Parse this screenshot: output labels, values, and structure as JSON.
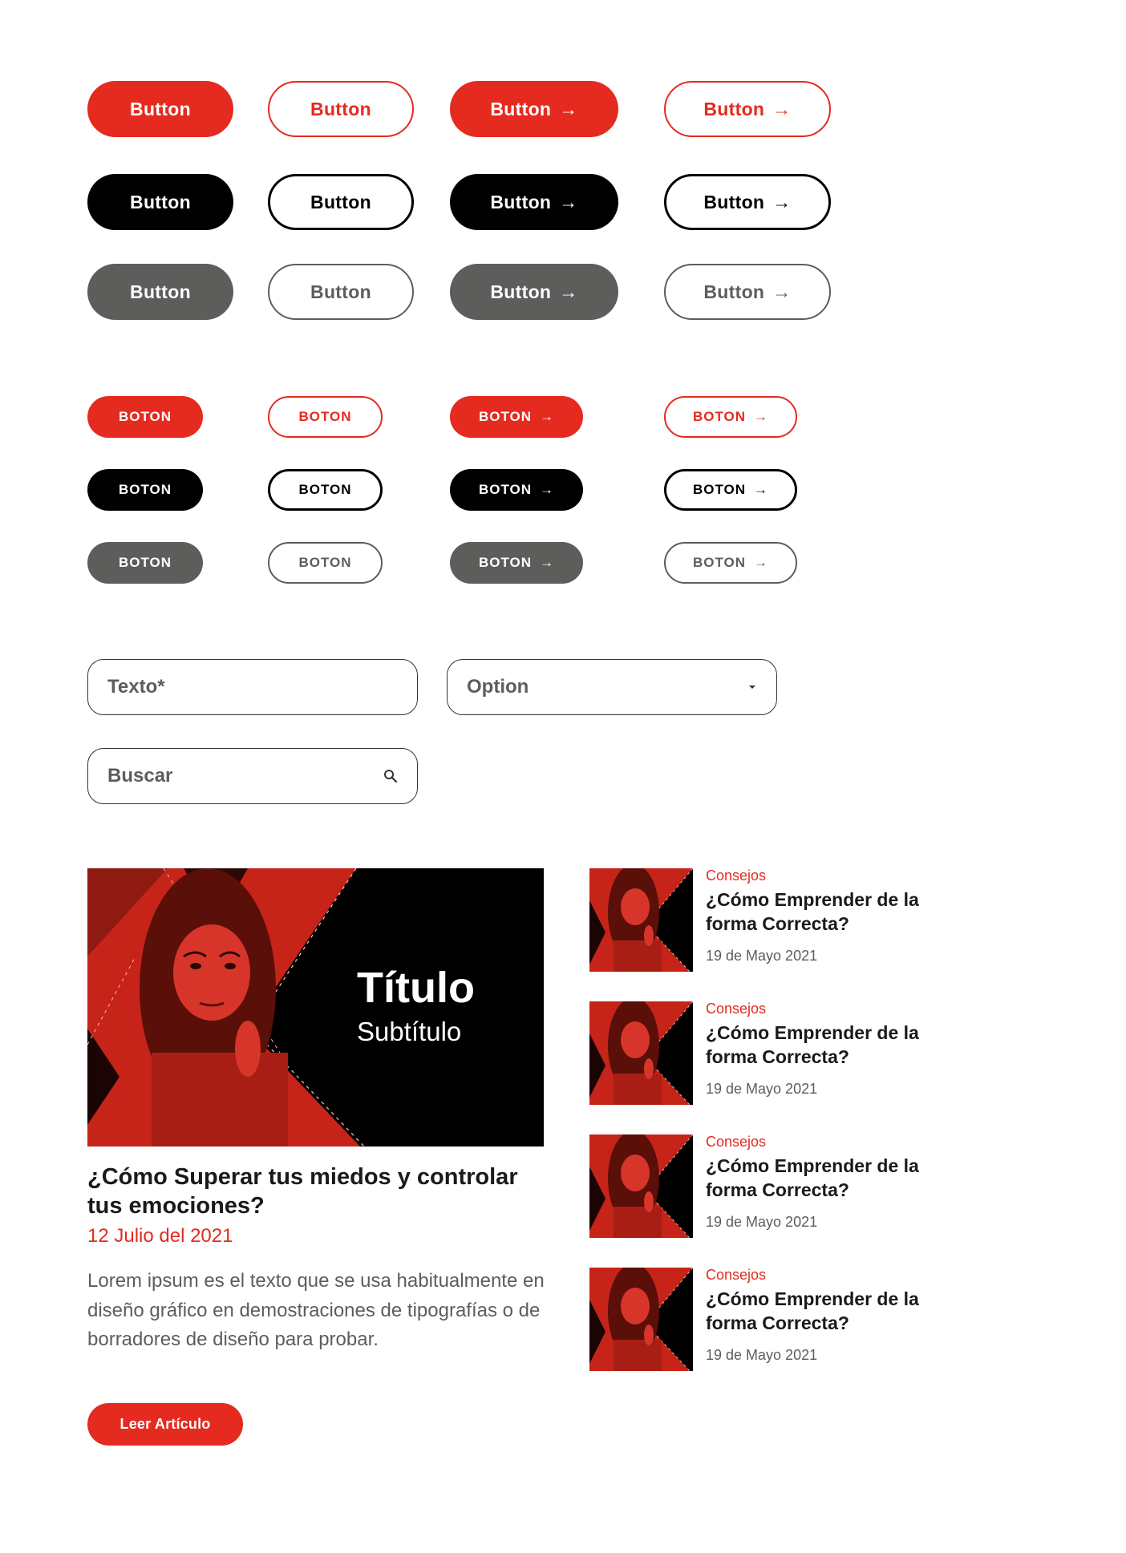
{
  "buttons_large": {
    "row1": [
      "Button",
      "Button",
      "Button",
      "Button"
    ],
    "row2": [
      "Button",
      "Button",
      "Button",
      "Button"
    ],
    "row3": [
      "Button",
      "Button",
      "Button",
      "Button"
    ]
  },
  "buttons_small": {
    "row1": [
      "BOTON",
      "BOTON",
      "BOTON",
      "BOTON"
    ],
    "row2": [
      "BOTON",
      "BOTON",
      "BOTON",
      "BOTON"
    ],
    "row3": [
      "BOTON",
      "BOTON",
      "BOTON",
      "BOTON"
    ]
  },
  "arrow": "→",
  "form": {
    "text_field": "Texto*",
    "select_value": "Option",
    "search_placeholder": "Buscar"
  },
  "featured": {
    "image_title": "Título",
    "image_subtitle": "Subtítulo",
    "title": "¿Cómo Superar tus miedos y controlar tus emociones?",
    "date": "12 Julio del 2021",
    "excerpt": "Lorem ipsum es el texto que se usa habitualmente en diseño gráfico en demostraciones de tipografías o de borradores de diseño para probar.",
    "button": "Leer Artículo"
  },
  "side_articles": [
    {
      "category": "Consejos",
      "title": "¿Cómo Emprender de la forma Correcta?",
      "date": "19 de Mayo 2021"
    },
    {
      "category": "Consejos",
      "title": "¿Cómo Emprender de la forma Correcta?",
      "date": "19 de Mayo 2021"
    },
    {
      "category": "Consejos",
      "title": "¿Cómo Emprender de la forma Correcta?",
      "date": "19 de Mayo 2021"
    },
    {
      "category": "Consejos",
      "title": "¿Cómo Emprender de la forma Correcta?",
      "date": "19 de Mayo 2021"
    }
  ],
  "colors": {
    "accent": "#e52a1f",
    "dark": "#000000",
    "gray": "#5d5d5b"
  },
  "icons": [
    "arrow-right-icon",
    "chevron-down-icon",
    "search-icon"
  ]
}
